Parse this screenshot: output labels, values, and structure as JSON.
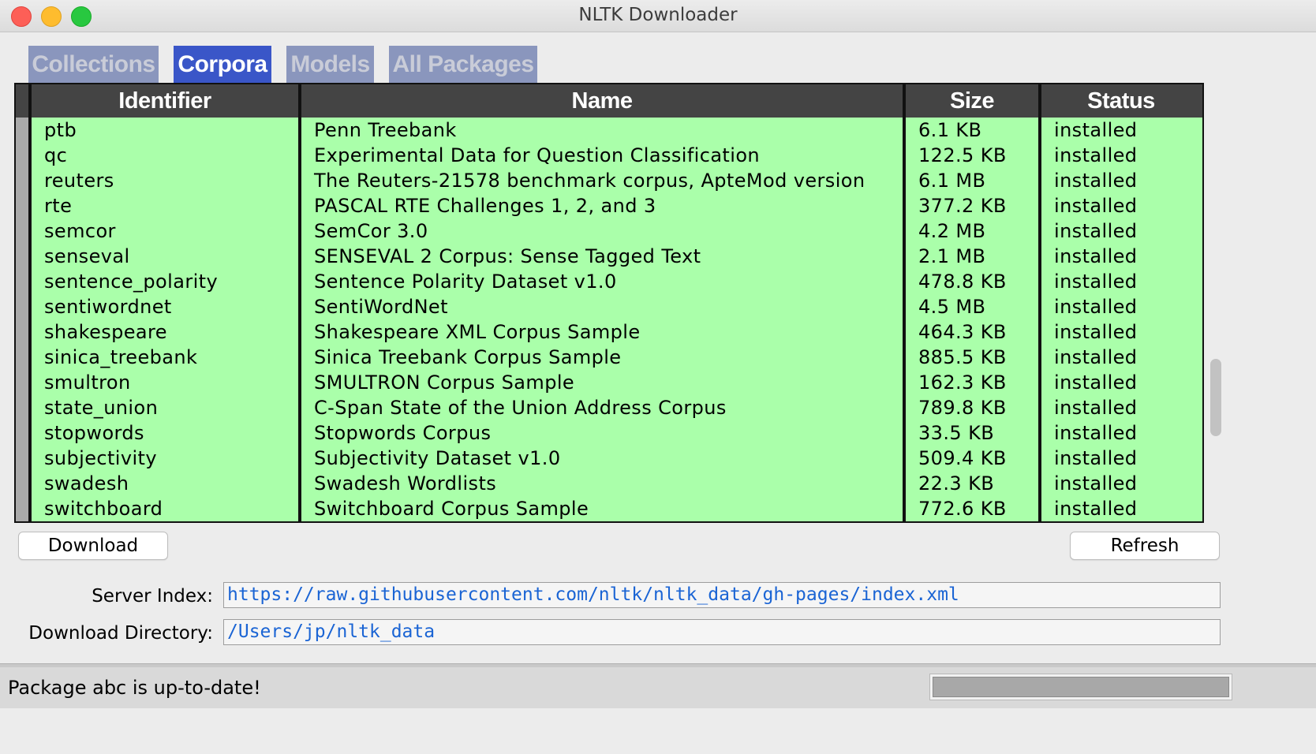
{
  "window": {
    "title": "NLTK Downloader"
  },
  "tabs": [
    {
      "label": "Collections",
      "active": false
    },
    {
      "label": "Corpora",
      "active": true
    },
    {
      "label": "Models",
      "active": false
    },
    {
      "label": "All Packages",
      "active": false
    }
  ],
  "table": {
    "columns": [
      "Identifier",
      "Name",
      "Size",
      "Status"
    ],
    "rows": [
      {
        "id": "ptb",
        "name": "Penn Treebank",
        "size": "6.1 KB",
        "status": "installed"
      },
      {
        "id": "qc",
        "name": "Experimental Data for Question Classification",
        "size": "122.5 KB",
        "status": "installed"
      },
      {
        "id": "reuters",
        "name": "The Reuters-21578 benchmark corpus, ApteMod version",
        "size": "6.1 MB",
        "status": "installed"
      },
      {
        "id": "rte",
        "name": "PASCAL RTE Challenges 1, 2, and 3",
        "size": "377.2 KB",
        "status": "installed"
      },
      {
        "id": "semcor",
        "name": "SemCor 3.0",
        "size": "4.2 MB",
        "status": "installed"
      },
      {
        "id": "senseval",
        "name": "SENSEVAL 2 Corpus: Sense Tagged Text",
        "size": "2.1 MB",
        "status": "installed"
      },
      {
        "id": "sentence_polarity",
        "name": "Sentence Polarity Dataset v1.0",
        "size": "478.8 KB",
        "status": "installed"
      },
      {
        "id": "sentiwordnet",
        "name": "SentiWordNet",
        "size": "4.5 MB",
        "status": "installed"
      },
      {
        "id": "shakespeare",
        "name": "Shakespeare XML Corpus Sample",
        "size": "464.3 KB",
        "status": "installed"
      },
      {
        "id": "sinica_treebank",
        "name": "Sinica Treebank Corpus Sample",
        "size": "885.5 KB",
        "status": "installed"
      },
      {
        "id": "smultron",
        "name": "SMULTRON Corpus Sample",
        "size": "162.3 KB",
        "status": "installed"
      },
      {
        "id": "state_union",
        "name": "C-Span State of the Union Address Corpus",
        "size": "789.8 KB",
        "status": "installed"
      },
      {
        "id": "stopwords",
        "name": "Stopwords Corpus",
        "size": "33.5 KB",
        "status": "installed"
      },
      {
        "id": "subjectivity",
        "name": "Subjectivity Dataset v1.0",
        "size": "509.4 KB",
        "status": "installed"
      },
      {
        "id": "swadesh",
        "name": "Swadesh Wordlists",
        "size": "22.3 KB",
        "status": "installed"
      },
      {
        "id": "switchboard",
        "name": "Switchboard Corpus Sample",
        "size": "772.6 KB",
        "status": "installed"
      }
    ]
  },
  "buttons": {
    "download": "Download",
    "refresh": "Refresh"
  },
  "server_index": {
    "label": "Server Index:",
    "value": "https://raw.githubusercontent.com/nltk/nltk_data/gh-pages/index.xml"
  },
  "download_directory": {
    "label": "Download Directory:",
    "value": "/Users/jp/nltk_data"
  },
  "status": {
    "message": "Package abc is up-to-date!"
  },
  "colors": {
    "row_background": "#aaffaa",
    "header_background": "#444444",
    "tab_active": "#3a56c8",
    "tab_inactive": "#8a96bd",
    "link_text": "#1a64d4"
  }
}
